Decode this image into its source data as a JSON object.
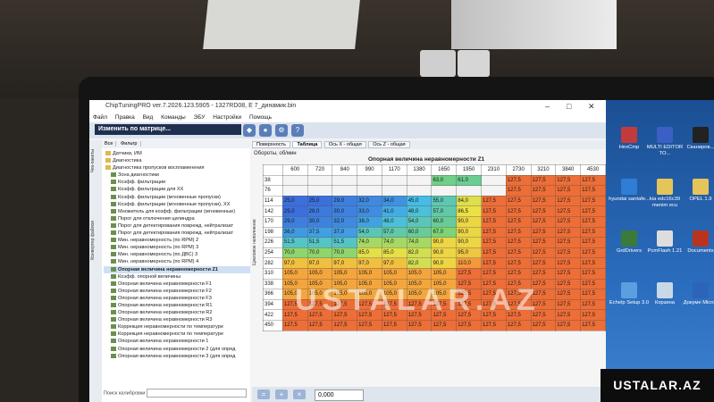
{
  "window": {
    "title": "ChipTuningPRO ver.7.2026.123.5905 - 1327RD08, E 7_динамик.bin",
    "menu": [
      "Файл",
      "Правка",
      "Вид",
      "Команды",
      "ЭБУ",
      "Настройки",
      "Помощь"
    ]
  },
  "toolbar": {
    "matrix_button": "Изменить по матрице..."
  },
  "left_panel": {
    "vertical_tabs": [
      "Чек-пакеты",
      "Конвертер файлов"
    ],
    "tabs": [
      "Все",
      "Фильтр"
    ],
    "tree": [
      "Датчики, ИМ",
      "Диагностика",
      "Диагностика пропусков воспламенения",
      "Зона диагностики",
      "Коэфф. фильтрации",
      "Коэфф. фильтрации для XX",
      "Коэфф. фильтрации (мгновенные пропуски)",
      "Коэфф. фильтрации (мгновенные пропуски), XX",
      "Множитель для коэфф. фильтрации (мгновенные)",
      "Порог для отключения цилиндра",
      "Порог для детектирования поврежд. нейтрализат",
      "Порог для детектирования поврежд. нейтрализат",
      "Мин. неравномерность (по RPM) 2",
      "Мин. неравномерность (по RPM) 3",
      "Мин. неравномерность (по ДВС) 3",
      "Мин. неравномерность (по RPM) 4",
      "Опорная величина неравномерности Z1",
      "Коэфф. опорной величины",
      "Опорная величина неравномерности F1",
      "Опорная величина неравномерности F2",
      "Опорная величина неравномерности F3",
      "Опорная величина неравномерности R1",
      "Опорная величина неравномерности R2",
      "Опорная величина неравномерности R3",
      "Коррекция неравномерности по температуре",
      "Коррекция неравномерности по температуре",
      "Опорная величина неравномерности 1",
      "Опорная величина неравномерности 2 (для опред",
      "Опорная величина неравномерности 3 (для опред"
    ],
    "selected_index": 16,
    "search_label": "Поиск калибровки"
  },
  "right_panel": {
    "tabs": [
      "Поверхность",
      "Таблица",
      "Ось X - общая",
      "Ось Z - общая"
    ],
    "active_tab": 1,
    "header_label": "Обороты, об/мин",
    "table_title": "Опорная величина неравномерности Z1",
    "y_axis_label": "Цикловое наполнение",
    "x_axis": [
      "600",
      "720",
      "840",
      "990",
      "1170",
      "1380",
      "1650",
      "1950",
      "2310",
      "2730",
      "3210",
      "3840",
      "4530"
    ],
    "rows": [
      {
        "y": "38",
        "cells": [
          "",
          "",
          "",
          "",
          "",
          "",
          "63,0",
          "61,0",
          "",
          "127,5",
          "127,5",
          "127,5",
          "127,5"
        ]
      },
      {
        "y": "76",
        "cells": [
          "",
          "",
          "",
          "",
          "",
          "",
          "",
          "",
          "",
          "127,5",
          "127,5",
          "127,5",
          "127,5"
        ]
      },
      {
        "y": "114",
        "cells": [
          "25,0",
          "25,0",
          "29,0",
          "32,0",
          "34,0",
          "45,0",
          "55,0",
          "84,0",
          "127,5",
          "127,5",
          "127,5",
          "127,5",
          "127,5"
        ]
      },
      {
        "y": "142",
        "cells": [
          "25,0",
          "28,0",
          "30,0",
          "33,0",
          "41,0",
          "48,0",
          "57,0",
          "86,5",
          "127,5",
          "127,5",
          "127,5",
          "127,5",
          "127,5"
        ]
      },
      {
        "y": "170",
        "cells": [
          "29,0",
          "30,0",
          "32,0",
          "38,0",
          "48,0",
          "54,0",
          "60,0",
          "90,0",
          "127,5",
          "127,5",
          "127,5",
          "127,5",
          "127,5"
        ]
      },
      {
        "y": "198",
        "cells": [
          "36,0",
          "37,5",
          "37,0",
          "54,0",
          "57,0",
          "60,0",
          "67,0",
          "90,0",
          "127,5",
          "127,5",
          "127,5",
          "127,5",
          "127,5"
        ]
      },
      {
        "y": "226",
        "cells": [
          "51,5",
          "51,5",
          "51,5",
          "74,0",
          "74,0",
          "74,0",
          "90,0",
          "90,0",
          "127,5",
          "127,5",
          "127,5",
          "127,5",
          "127,5"
        ]
      },
      {
        "y": "254",
        "cells": [
          "70,0",
          "70,0",
          "70,0",
          "85,0",
          "85,0",
          "82,0",
          "90,0",
          "95,0",
          "127,5",
          "127,5",
          "127,5",
          "127,5",
          "127,5"
        ]
      },
      {
        "y": "282",
        "cells": [
          "97,0",
          "97,0",
          "97,0",
          "97,0",
          "97,0",
          "82,0",
          "90,0",
          "110,0",
          "127,5",
          "127,5",
          "127,5",
          "127,5",
          "127,5"
        ]
      },
      {
        "y": "310",
        "cells": [
          "105,0",
          "105,0",
          "105,0",
          "105,0",
          "105,0",
          "105,0",
          "105,0",
          "127,5",
          "127,5",
          "127,5",
          "127,5",
          "127,5",
          "127,5"
        ]
      },
      {
        "y": "338",
        "cells": [
          "105,0",
          "105,0",
          "105,0",
          "105,0",
          "105,0",
          "105,0",
          "105,0",
          "127,5",
          "127,5",
          "127,5",
          "127,5",
          "127,5",
          "127,5"
        ]
      },
      {
        "y": "366",
        "cells": [
          "105,0",
          "105,0",
          "105,0",
          "105,0",
          "105,0",
          "105,0",
          "105,0",
          "127,5",
          "127,5",
          "127,5",
          "127,5",
          "127,5",
          "127,5"
        ]
      },
      {
        "y": "394",
        "cells": [
          "127,5",
          "127,5",
          "127,5",
          "127,5",
          "127,5",
          "127,5",
          "127,5",
          "127,5",
          "127,5",
          "127,5",
          "127,5",
          "127,5",
          "127,5"
        ]
      },
      {
        "y": "422",
        "cells": [
          "127,5",
          "127,5",
          "127,5",
          "127,5",
          "127,5",
          "127,5",
          "127,5",
          "127,5",
          "127,5",
          "127,5",
          "127,5",
          "127,5",
          "127,5"
        ]
      },
      {
        "y": "450",
        "cells": [
          "127,5",
          "127,5",
          "127,5",
          "127,5",
          "127,5",
          "127,5",
          "127,5",
          "127,5",
          "127,5",
          "127,5",
          "127,5",
          "127,5",
          "127,5"
        ]
      }
    ],
    "value_field": "0,000"
  },
  "desktop": {
    "icons": [
      {
        "label": "HexCmp",
        "color": "#c23b3b"
      },
      {
        "label": "MULTI EDITOR TO...",
        "color": "#3b5fc2"
      },
      {
        "label": "Сканиров...",
        "color": "#222222"
      },
      {
        "label": "hyundai santafe...",
        "color": "#2e7dd6"
      },
      {
        "label": "kia edc16c39 menim ecu",
        "color": "#e5c55a"
      },
      {
        "label": "OPEL 1.9",
        "color": "#e5c55a"
      },
      {
        "label": "GrdDrivers",
        "color": "#3c7a3c"
      },
      {
        "label": "PcmFlash 1.21",
        "color": "#dddddd"
      },
      {
        "label": "Documents",
        "color": "#b8341f"
      },
      {
        "label": "Echelp Setup 3.0",
        "color": "#5aa0e0"
      },
      {
        "label": "Корзина",
        "color": "#c9d8e8"
      },
      {
        "label": "Докуме Micros",
        "color": "#2b64b8"
      }
    ]
  },
  "watermark": "USTALAR.AZ",
  "brand": "USTALAR.AZ"
}
